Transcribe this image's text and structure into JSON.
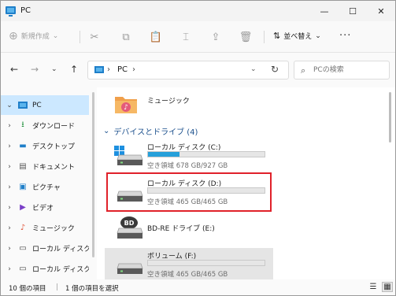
{
  "window": {
    "title": "PC",
    "icon": "pc-icon",
    "minimize": "—",
    "maximize": "☐",
    "close": "✕"
  },
  "commandbar": {
    "new_label": "新規作成",
    "new_chevron": "⌄",
    "cut_icon": "✂",
    "copy_icon": "⧉",
    "paste_icon": "📋",
    "rename_icon": "⌶",
    "share_icon": "⇪",
    "delete_icon": "🗑",
    "sort_label": "並べ替え",
    "sort_chevron": "⌄",
    "more_label": "···"
  },
  "address": {
    "back": "←",
    "forward": "→",
    "history": "⌄",
    "up": "↑",
    "separator": "›",
    "crumb": "PC",
    "dropdown": "⌄",
    "refresh": "↻"
  },
  "search": {
    "icon": "⌕",
    "placeholder": "PCの検索"
  },
  "sidebar": {
    "items": [
      {
        "label": "PC",
        "chevron": "⌄",
        "icon": "pc-icon",
        "selected": true
      },
      {
        "label": "ダウンロード",
        "chevron": "›",
        "icon": "download-icon",
        "glyph": "⭳",
        "color": "#1f8f3a"
      },
      {
        "label": "デスクトップ",
        "chevron": "›",
        "icon": "desktop-icon",
        "glyph": "▬",
        "color": "#1f7fc9"
      },
      {
        "label": "ドキュメント",
        "chevron": "›",
        "icon": "document-icon",
        "glyph": "▤",
        "color": "#555555"
      },
      {
        "label": "ピクチャ",
        "chevron": "›",
        "icon": "pictures-icon",
        "glyph": "▣",
        "color": "#1f7fc9"
      },
      {
        "label": "ビデオ",
        "chevron": "›",
        "icon": "video-icon",
        "glyph": "▶",
        "color": "#7a3fc7"
      },
      {
        "label": "ミュージック",
        "chevron": "›",
        "icon": "music-icon",
        "glyph": "♪",
        "color": "#e0553a"
      },
      {
        "label": "ローカル ディスク (",
        "chevron": "›",
        "icon": "drive-icon",
        "glyph": "▭",
        "color": "#444444"
      },
      {
        "label": "ローカル ディスク (",
        "chevron": "›",
        "icon": "drive-icon",
        "glyph": "▭",
        "color": "#444444"
      }
    ]
  },
  "main": {
    "music_folder_label": "ミュージック",
    "group_chevron": "⌄",
    "group_title": "デバイスとドライブ (4)",
    "drives": [
      {
        "name": "ローカル ディスク (C:)",
        "free": "空き領域 678 GB/927 GB",
        "used_fraction": 0.27,
        "icon": "windows-drive-icon"
      },
      {
        "name": "ローカル ディスク (D:)",
        "free": "空き領域 465 GB/465 GB",
        "used_fraction": 0.0,
        "icon": "drive-icon"
      },
      {
        "name": "BD-RE ドライブ (E:)",
        "icon": "bd-drive-icon",
        "badge": "BD"
      },
      {
        "name": "ボリューム (F:)",
        "free": "空き領域 465 GB/465 GB",
        "used_fraction": 0.0,
        "icon": "drive-icon"
      }
    ]
  },
  "status": {
    "count": "10 個の項目",
    "separator": "|",
    "selection": "1 個の項目を選択",
    "details_view_icon": "☰",
    "tiles_view_icon": "▦"
  },
  "colors": {
    "accent": "#26a0da",
    "selected_bg": "#cce8ff",
    "highlight_box": "#e0212a",
    "group_title": "#1a4f8c"
  }
}
